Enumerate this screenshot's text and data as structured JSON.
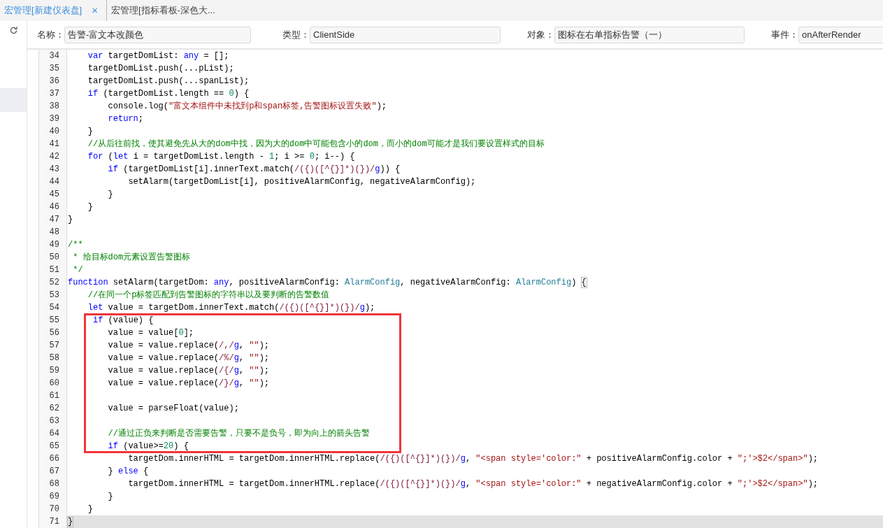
{
  "tabs": [
    {
      "label": "宏管理[新建仪表盘]",
      "selected": true,
      "close": "×"
    },
    {
      "label": "宏管理[指标看板-深色大...",
      "selected": false
    }
  ],
  "sidebar": {
    "items": [
      {
        "selected": true
      }
    ]
  },
  "form": [
    {
      "label": "名称：",
      "value": "告警-富文本改颜色"
    },
    {
      "label": "类型：",
      "value": "ClientSide"
    },
    {
      "label": "对象：",
      "value": "图标在右单指标告警（一）"
    },
    {
      "label": "事件：",
      "value": "onAfterRender"
    }
  ],
  "editor": {
    "lines": [
      {
        "number": "34",
        "active": false,
        "segments": [
          {
            "kind": "keyword",
            "text": "    var"
          },
          {
            "kind": "plain",
            "text": " targetDomList: "
          },
          {
            "kind": "keyword",
            "text": "any"
          },
          {
            "kind": "plain",
            "text": " = [];"
          }
        ]
      },
      {
        "number": "35",
        "active": false,
        "segments": [
          {
            "kind": "plain",
            "text": "    targetDomList.push(...pList);"
          }
        ]
      },
      {
        "number": "36",
        "active": false,
        "segments": [
          {
            "kind": "plain",
            "text": "    targetDomList.push(...spanList);"
          }
        ]
      },
      {
        "number": "37",
        "active": false,
        "segments": [
          {
            "kind": "keyword",
            "text": "    if"
          },
          {
            "kind": "plain",
            "text": " (targetDomList.length == "
          },
          {
            "kind": "number",
            "text": "0"
          },
          {
            "kind": "plain",
            "text": ") {"
          }
        ]
      },
      {
        "number": "38",
        "active": false,
        "segments": [
          {
            "kind": "plain",
            "text": "        console.log("
          },
          {
            "kind": "string",
            "text": "\"富文本组件中未找到p和span标签,告警图标设置失败\""
          },
          {
            "kind": "plain",
            "text": ");"
          }
        ]
      },
      {
        "number": "39",
        "active": false,
        "segments": [
          {
            "kind": "keyword",
            "text": "        return"
          },
          {
            "kind": "plain",
            "text": ";"
          }
        ]
      },
      {
        "number": "40",
        "active": false,
        "segments": [
          {
            "kind": "plain",
            "text": "    }"
          }
        ]
      },
      {
        "number": "41",
        "active": false,
        "segments": [
          {
            "kind": "comment",
            "text": "    //从后往前找，使其避免先从大的dom中找，因为大的dom中可能包含小的dom，而小的dom可能才是我们要设置样式的目标"
          }
        ]
      },
      {
        "number": "42",
        "active": false,
        "segments": [
          {
            "kind": "keyword",
            "text": "    for"
          },
          {
            "kind": "plain",
            "text": " ("
          },
          {
            "kind": "keyword",
            "text": "let"
          },
          {
            "kind": "plain",
            "text": " i = targetDomList.length - "
          },
          {
            "kind": "number",
            "text": "1"
          },
          {
            "kind": "plain",
            "text": "; i >= "
          },
          {
            "kind": "number",
            "text": "0"
          },
          {
            "kind": "plain",
            "text": "; i--) {"
          }
        ]
      },
      {
        "number": "43",
        "active": false,
        "segments": [
          {
            "kind": "keyword",
            "text": "        if"
          },
          {
            "kind": "plain",
            "text": " (targetDomList[i].innerText.match("
          },
          {
            "kind": "regex",
            "text": "/({)([^{}]*)(})/"
          },
          {
            "kind": "flag",
            "text": "g"
          },
          {
            "kind": "plain",
            "text": ")) {"
          }
        ]
      },
      {
        "number": "44",
        "active": false,
        "segments": [
          {
            "kind": "plain",
            "text": "            setAlarm(targetDomList[i], positiveAlarmConfig, negativeAlarmConfig);"
          }
        ]
      },
      {
        "number": "45",
        "active": false,
        "segments": [
          {
            "kind": "plain",
            "text": "        }"
          }
        ]
      },
      {
        "number": "46",
        "active": false,
        "segments": [
          {
            "kind": "plain",
            "text": "    }"
          }
        ]
      },
      {
        "number": "47",
        "active": false,
        "segments": [
          {
            "kind": "plain",
            "text": "}"
          }
        ]
      },
      {
        "number": "48",
        "active": false
      },
      {
        "number": "49",
        "active": false,
        "segments": [
          {
            "kind": "comment",
            "text": "/**"
          }
        ]
      },
      {
        "number": "50",
        "active": false,
        "segments": [
          {
            "kind": "comment",
            "text": " * 给目标dom元素设置告警图标"
          }
        ]
      },
      {
        "number": "51",
        "active": false,
        "segments": [
          {
            "kind": "comment",
            "text": " */"
          }
        ]
      },
      {
        "number": "52",
        "active": false,
        "segments": [
          {
            "kind": "keyword",
            "text": "function"
          },
          {
            "kind": "plain",
            "text": " setAlarm(targetDom: "
          },
          {
            "kind": "keyword",
            "text": "any"
          },
          {
            "kind": "plain",
            "text": ", positiveAlarmConfig: "
          },
          {
            "kind": "type",
            "text": "AlarmConfig"
          },
          {
            "kind": "plain",
            "text": ", negativeAlarmConfig: "
          },
          {
            "kind": "type",
            "text": "AlarmConfig"
          },
          {
            "kind": "plain",
            "text": ") "
          },
          {
            "kind": "brace",
            "text": "{"
          }
        ]
      },
      {
        "number": "53",
        "active": false,
        "segments": [
          {
            "kind": "comment",
            "text": "    //在同一个p标签匹配到告警图标的字符串以及要判断的告警数值"
          }
        ]
      },
      {
        "number": "54",
        "active": false,
        "segments": [
          {
            "kind": "keyword",
            "text": "    let"
          },
          {
            "kind": "plain",
            "text": " value = targetDom.innerText.match("
          },
          {
            "kind": "regex",
            "text": "/({)([^{}]*)(})/"
          },
          {
            "kind": "flag",
            "text": "g"
          },
          {
            "kind": "plain",
            "text": ");"
          }
        ]
      },
      {
        "number": "55",
        "active": false,
        "segments": [
          {
            "kind": "keyword",
            "text": "     if"
          },
          {
            "kind": "plain",
            "text": " (value) {"
          }
        ]
      },
      {
        "number": "56",
        "active": false,
        "segments": [
          {
            "kind": "plain",
            "text": "        value = value["
          },
          {
            "kind": "number",
            "text": "0"
          },
          {
            "kind": "plain",
            "text": "];"
          }
        ]
      },
      {
        "number": "57",
        "active": false,
        "segments": [
          {
            "kind": "plain",
            "text": "        value = value.replace("
          },
          {
            "kind": "regex",
            "text": "/,/"
          },
          {
            "kind": "flag",
            "text": "g"
          },
          {
            "kind": "plain",
            "text": ", "
          },
          {
            "kind": "string",
            "text": "\"\""
          },
          {
            "kind": "plain",
            "text": ");"
          }
        ]
      },
      {
        "number": "58",
        "active": false,
        "segments": [
          {
            "kind": "plain",
            "text": "        value = value.replace("
          },
          {
            "kind": "regex",
            "text": "/%/"
          },
          {
            "kind": "flag",
            "text": "g"
          },
          {
            "kind": "plain",
            "text": ", "
          },
          {
            "kind": "string",
            "text": "\"\""
          },
          {
            "kind": "plain",
            "text": ");"
          }
        ]
      },
      {
        "number": "59",
        "active": false,
        "segments": [
          {
            "kind": "plain",
            "text": "        value = value.replace("
          },
          {
            "kind": "regex",
            "text": "/{/"
          },
          {
            "kind": "flag",
            "text": "g"
          },
          {
            "kind": "plain",
            "text": ", "
          },
          {
            "kind": "string",
            "text": "\"\""
          },
          {
            "kind": "plain",
            "text": ");"
          }
        ]
      },
      {
        "number": "60",
        "active": false,
        "segments": [
          {
            "kind": "plain",
            "text": "        value = value.replace("
          },
          {
            "kind": "regex",
            "text": "/}/"
          },
          {
            "kind": "flag",
            "text": "g"
          },
          {
            "kind": "plain",
            "text": ", "
          },
          {
            "kind": "string",
            "text": "\"\""
          },
          {
            "kind": "plain",
            "text": ");"
          }
        ]
      },
      {
        "number": "61",
        "active": false
      },
      {
        "number": "62",
        "active": false,
        "segments": [
          {
            "kind": "plain",
            "text": "        value = parseFloat(value);"
          }
        ]
      },
      {
        "number": "63",
        "active": false
      },
      {
        "number": "64",
        "active": false,
        "segments": [
          {
            "kind": "comment",
            "text": "        //通过正负来判断是否需要告警，只要不是负号，即为向上的箭头告警"
          }
        ]
      },
      {
        "number": "65",
        "active": false,
        "segments": [
          {
            "kind": "keyword",
            "text": "        if"
          },
          {
            "kind": "plain",
            "text": " (value>="
          },
          {
            "kind": "number",
            "text": "20"
          },
          {
            "kind": "plain",
            "text": ") {"
          }
        ]
      },
      {
        "number": "66",
        "active": false,
        "segments": [
          {
            "kind": "plain",
            "text": "            targetDom.innerHTML = targetDom.innerHTML.replace("
          },
          {
            "kind": "regex",
            "text": "/({)([^{}]*)(})/"
          },
          {
            "kind": "flag",
            "text": "g"
          },
          {
            "kind": "plain",
            "text": ", "
          },
          {
            "kind": "string",
            "text": "\"<span style='color:\""
          },
          {
            "kind": "plain",
            "text": " + positiveAlarmConfig.color + "
          },
          {
            "kind": "string",
            "text": "\";'>$2</span>\""
          },
          {
            "kind": "plain",
            "text": ");"
          }
        ]
      },
      {
        "number": "67",
        "active": false,
        "segments": [
          {
            "kind": "plain",
            "text": "        } "
          },
          {
            "kind": "keyword",
            "text": "else"
          },
          {
            "kind": "plain",
            "text": " {"
          }
        ]
      },
      {
        "number": "68",
        "active": false,
        "segments": [
          {
            "kind": "plain",
            "text": "            targetDom.innerHTML = targetDom.innerHTML.replace("
          },
          {
            "kind": "regex",
            "text": "/({)([^{}]*)(})/"
          },
          {
            "kind": "flag",
            "text": "g"
          },
          {
            "kind": "plain",
            "text": ", "
          },
          {
            "kind": "string",
            "text": "\"<span style='color:\""
          },
          {
            "kind": "plain",
            "text": " + negativeAlarmConfig.color + "
          },
          {
            "kind": "string",
            "text": "\";'>$2</span>\""
          },
          {
            "kind": "plain",
            "text": ");"
          }
        ]
      },
      {
        "number": "69",
        "active": false,
        "segments": [
          {
            "kind": "plain",
            "text": "        }"
          }
        ]
      },
      {
        "number": "70",
        "active": false,
        "segments": [
          {
            "kind": "plain",
            "text": "    }"
          }
        ]
      },
      {
        "number": "71",
        "active": true,
        "segments": [
          {
            "kind": "brace",
            "text": "}"
          }
        ]
      }
    ]
  }
}
